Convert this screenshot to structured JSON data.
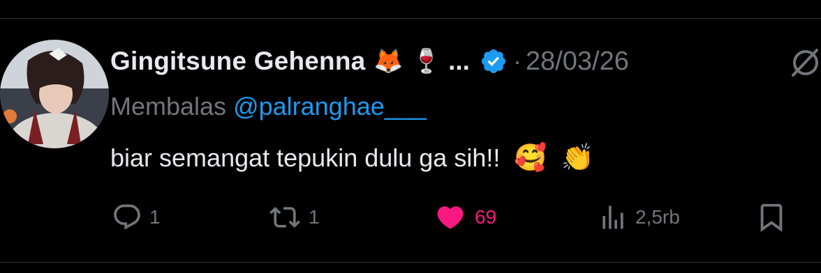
{
  "tweet": {
    "display_name": "Gingitsune Gehenna",
    "name_emojis": [
      "🦊",
      "🍷"
    ],
    "ellipsis": "...",
    "separator": "·",
    "date": "28/03/26",
    "reply_label": "Membalas",
    "reply_to": "@palranghae___",
    "text": "biar semangat tepukin dulu ga sih!!",
    "text_emojis": [
      "🥰",
      "👏"
    ]
  },
  "actions": {
    "replies": "1",
    "reposts": "1",
    "likes": "69",
    "views": "2,5rb"
  },
  "colors": {
    "background": "#000000",
    "text": "#e7e9ea",
    "muted": "#71767b",
    "link": "#1d9bf0",
    "like": "#f91880",
    "verified": "#1d9bf0"
  },
  "icons": {
    "verified": "verified-badge-icon",
    "grok": "grok-icon",
    "reply": "reply-icon",
    "repost": "repost-icon",
    "like": "heart-icon",
    "views": "views-icon",
    "bookmark": "bookmark-icon"
  }
}
